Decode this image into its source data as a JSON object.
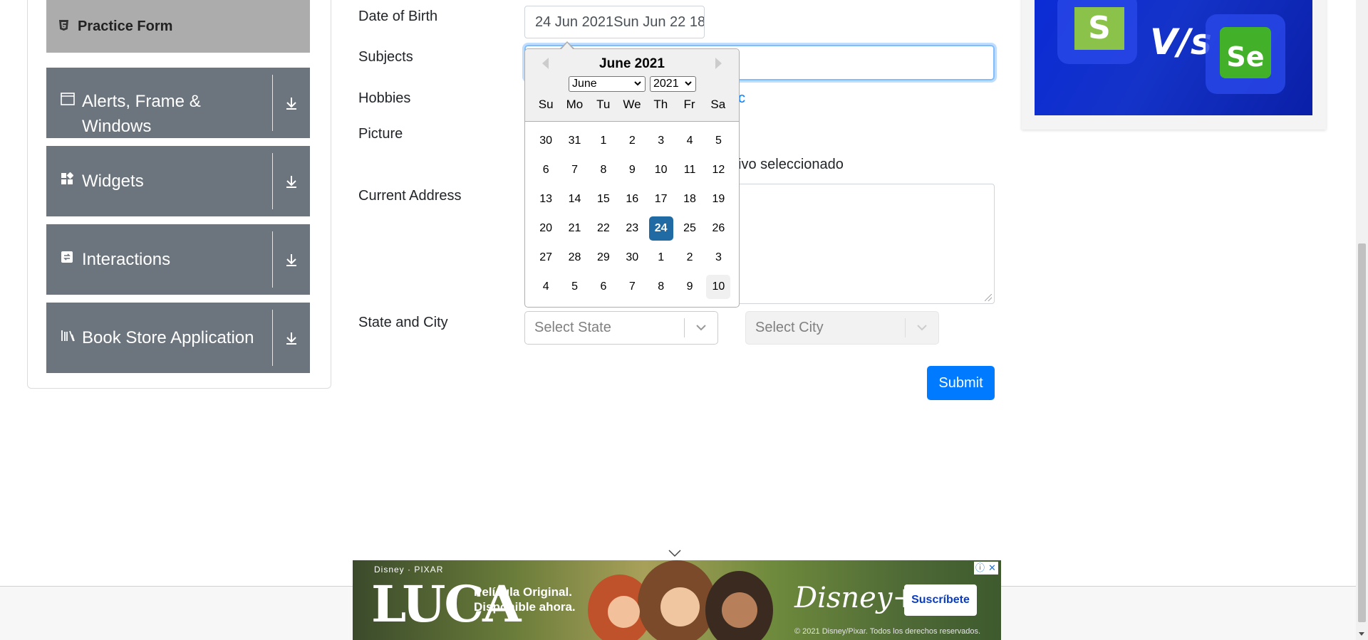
{
  "sidebar": {
    "active_item": "Practice Form",
    "groups": [
      {
        "label": "Alerts, Frame & Windows",
        "line1": "Alerts, Frame &",
        "line2": "Windows"
      },
      {
        "label": "Widgets"
      },
      {
        "label": "Interactions"
      },
      {
        "label": "Book Store Application"
      }
    ]
  },
  "form": {
    "dob_label": "Date of Birth",
    "dob_value": "24 Jun 2021Sun Jun 22 18",
    "subjects_label": "Subjects",
    "hobbies_label": "Hobbies",
    "hobbies_visible_tail": "c",
    "picture_label": "Picture",
    "file_status_tail": "ivo seleccionado",
    "address_label": "Current Address",
    "state_city_label": "State and City",
    "state_placeholder": "Select State",
    "city_placeholder": "Select City",
    "submit_label": "Submit"
  },
  "datepicker": {
    "current_month": "June 2021",
    "month_select": "June",
    "year_select": "2021",
    "weekdays": [
      "Su",
      "Mo",
      "Tu",
      "We",
      "Th",
      "Fr",
      "Sa"
    ],
    "weeks": [
      [
        "30",
        "31",
        "1",
        "2",
        "3",
        "4",
        "5"
      ],
      [
        "6",
        "7",
        "8",
        "9",
        "10",
        "11",
        "12"
      ],
      [
        "13",
        "14",
        "15",
        "16",
        "17",
        "18",
        "19"
      ],
      [
        "20",
        "21",
        "22",
        "23",
        "24",
        "25",
        "26"
      ],
      [
        "27",
        "28",
        "29",
        "30",
        "1",
        "2",
        "3"
      ],
      [
        "4",
        "5",
        "6",
        "7",
        "8",
        "9",
        "10"
      ]
    ],
    "selected_day": "24",
    "highlighted_day": "10"
  },
  "bottom_ad": {
    "brand": "Disney · PIXAR",
    "title": "LUCA",
    "tagline_line1": "Película Original.",
    "tagline_line2": "Disponible ahora.",
    "disney_logo": "Disney+",
    "subscribe_label": "Suscríbete",
    "legal": "© 2021 Disney/Pixar. Todos los derechos reservados."
  },
  "right_ad": {
    "left_logo": "S",
    "vs_text": "V/s",
    "right_logo": "Se"
  },
  "colors": {
    "primary": "#007bff",
    "sidebar_group": "#6c757d",
    "sidebar_active": "#acacac",
    "datepicker_selected": "#216ba5",
    "focus_border": "#80bdff"
  }
}
